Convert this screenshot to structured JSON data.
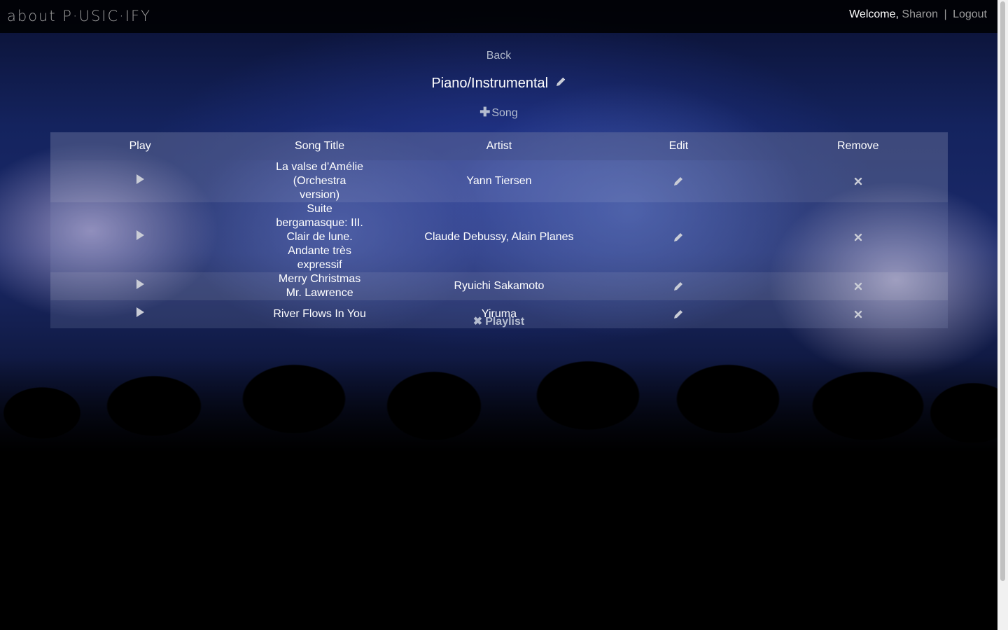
{
  "navbar": {
    "brand": "about P·USIC·IFY",
    "welcome": "Welcome,",
    "username": "Sharon",
    "separator": "|",
    "logout": "Logout"
  },
  "page": {
    "back": "Back",
    "playlist_title": "Piano/Instrumental",
    "add_song_label": "Song",
    "delete_playlist_label": "Playlist"
  },
  "table": {
    "headers": [
      "Play",
      "Song Title",
      "Artist",
      "Edit",
      "Remove"
    ],
    "rows": [
      {
        "title": "La valse d'Amélie (Orchestra version)",
        "artist": "Yann Tiersen"
      },
      {
        "title": "Suite bergamasque: III. Clair de lune. Andante très expressif",
        "artist": "Claude Debussy, Alain Planes"
      },
      {
        "title": "Merry Christmas Mr. Lawrence",
        "artist": "Ryuichi Sakamoto"
      },
      {
        "title": "River Flows In You",
        "artist": "Yiruma"
      }
    ]
  },
  "icons": {
    "play": "play-icon",
    "edit": "pencil-icon",
    "remove": "close-icon",
    "add": "plus-icon",
    "delete": "close-icon"
  },
  "colors": {
    "navbar_bg": "#0d0d0d",
    "muted_text": "#9d9d9d",
    "icon_gray": "#c9ccd6"
  }
}
